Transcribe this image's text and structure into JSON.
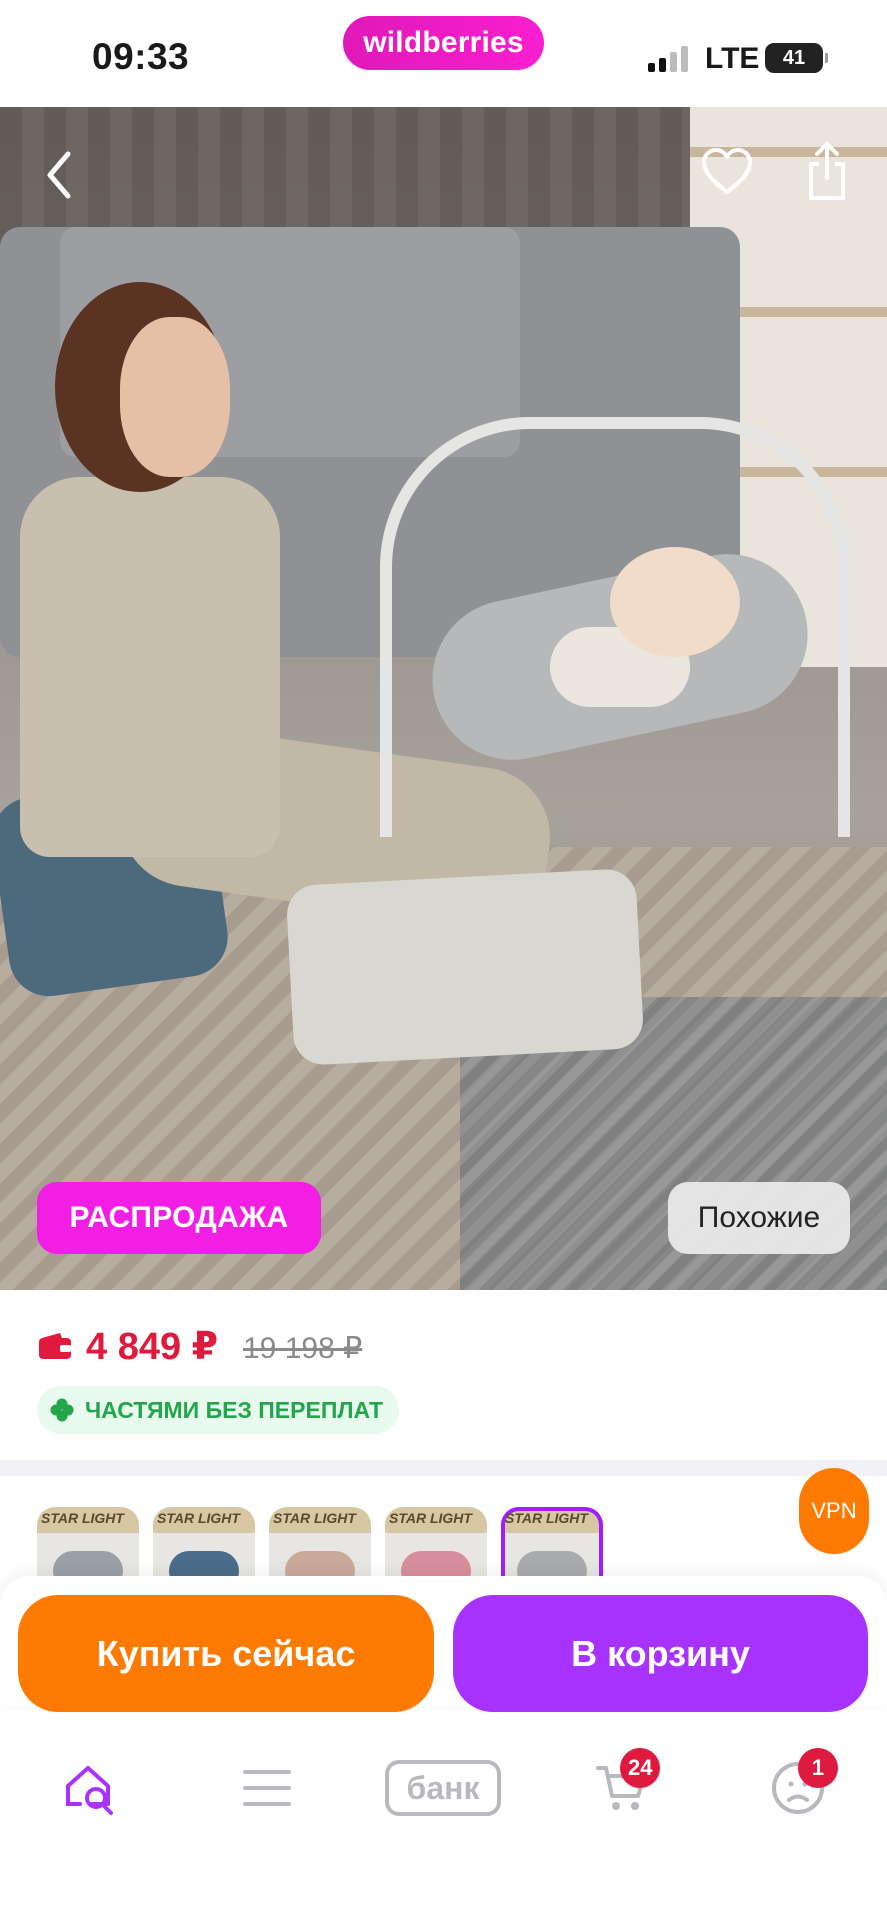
{
  "status_bar": {
    "time": "09:33",
    "brand": "wildberries",
    "network": "LTE",
    "battery": "41"
  },
  "product": {
    "sale_badge": "РАСПРОДАЖА",
    "similar_label": "Похожие",
    "price": "4 849 ₽",
    "old_price": "19 198 ₽",
    "installment_label": "ЧАСТЯМИ БЕЗ ПЕРЕПЛАТ",
    "variant_label": "STAR LIGHT"
  },
  "vpn_label": "VPN",
  "actions": {
    "buy_now": "Купить сейчас",
    "add_to_cart": "В корзину"
  },
  "nav": {
    "bank_label": "банк",
    "cart_count": "24",
    "profile_count": "1"
  },
  "colors": {
    "brand_pink": "#f21ee3",
    "price_red": "#e0193e",
    "buy_orange": "#ff7a00",
    "cart_purple": "#a832ff",
    "installment_green": "#23a54c"
  }
}
